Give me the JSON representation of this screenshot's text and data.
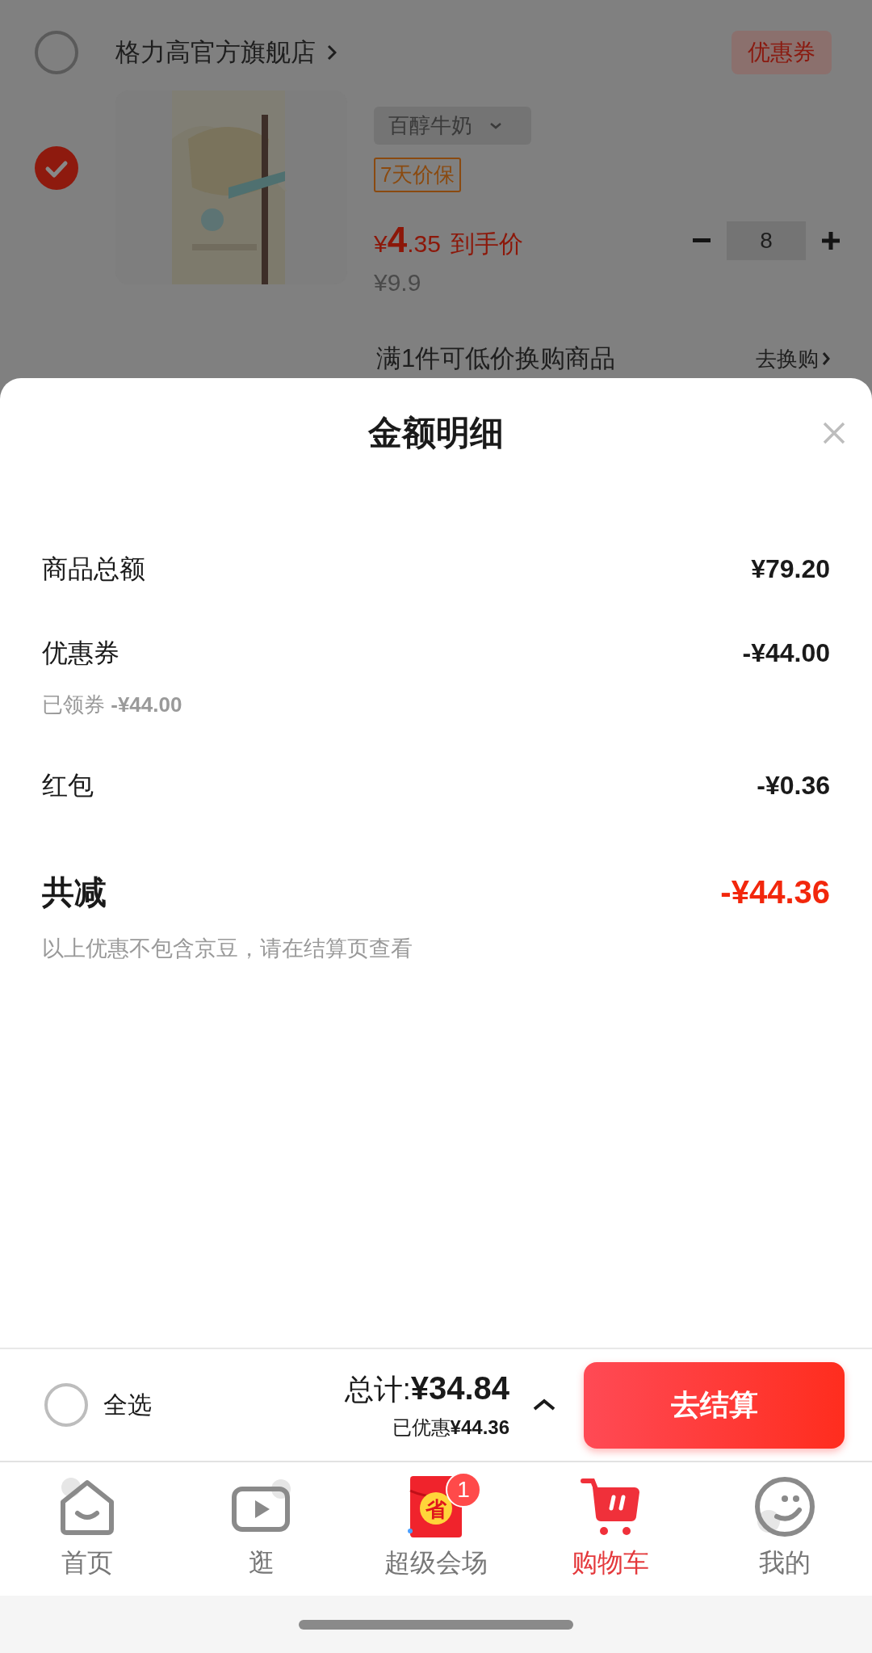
{
  "store": {
    "name": "格力高官方旗舰店",
    "selected": false,
    "coupon_button": "优惠券"
  },
  "item": {
    "selected": true,
    "variant": "百醇牛奶",
    "tag": "7天价保",
    "price_symbol": "¥",
    "price_int": "4",
    "price_dec": ".35",
    "price_label": "到手价",
    "original_price": "¥9.9",
    "quantity": "8"
  },
  "promo": {
    "text": "满1件可低价换购商品",
    "link": "去换购"
  },
  "sheet": {
    "title": "金额明细",
    "rows": [
      {
        "label": "商品总额",
        "value": "¥79.20"
      },
      {
        "label": "优惠券",
        "value": "-¥44.00",
        "note": "已领券 **-¥44.00**"
      },
      {
        "label": "红包",
        "value": "-¥0.36"
      }
    ],
    "total": {
      "label": "共减",
      "value": "-¥44.36"
    },
    "footnote": "以上优惠不包含京豆，请在结算页查看"
  },
  "bottom_bar": {
    "select_all": {
      "label": "全选",
      "checked": false
    },
    "total": "总计:**¥34.84**",
    "discount": "已优惠**¥44.36**",
    "expanded": false,
    "checkout": "去结算"
  },
  "tabs": [
    {
      "label": "首页",
      "kind": "home",
      "selected": false
    },
    {
      "label": "逛",
      "kind": "video",
      "selected": false
    },
    {
      "label": "超级会场",
      "kind": "promo",
      "icon_text": "省",
      "badge": "1",
      "selected": false
    },
    {
      "label": "购物车",
      "kind": "cart",
      "selected": true
    },
    {
      "label": "我的",
      "kind": "profile",
      "selected": false
    }
  ]
}
